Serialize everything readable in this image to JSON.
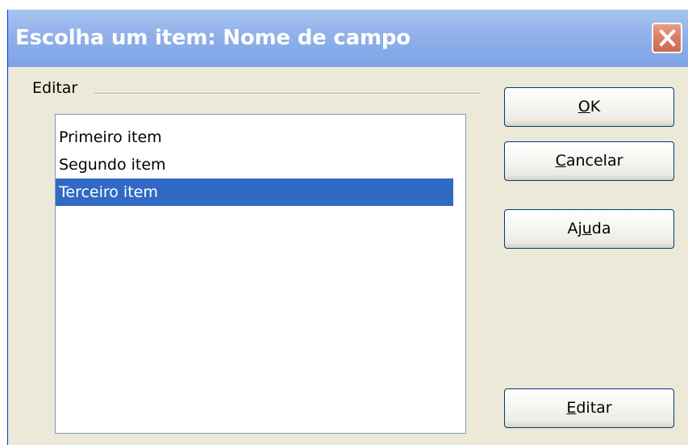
{
  "window": {
    "title": "Escolha um item: Nome de campo"
  },
  "titlebar": {
    "close_icon": "close-icon",
    "close_color": "#d97d63"
  },
  "group": {
    "label": "Editar"
  },
  "list": {
    "items": [
      "Primeiro item",
      "Segundo item",
      "Terceiro item"
    ],
    "selected_index": 2,
    "selected_color": "#316ac5"
  },
  "buttons": {
    "ok": {
      "pre": "",
      "acc": "O",
      "post": "K"
    },
    "cancel": {
      "pre": "",
      "acc": "C",
      "post": "ancelar"
    },
    "help": {
      "pre": "Aj",
      "acc": "u",
      "post": "da"
    },
    "edit": {
      "pre": "",
      "acc": "E",
      "post": "ditar"
    }
  }
}
